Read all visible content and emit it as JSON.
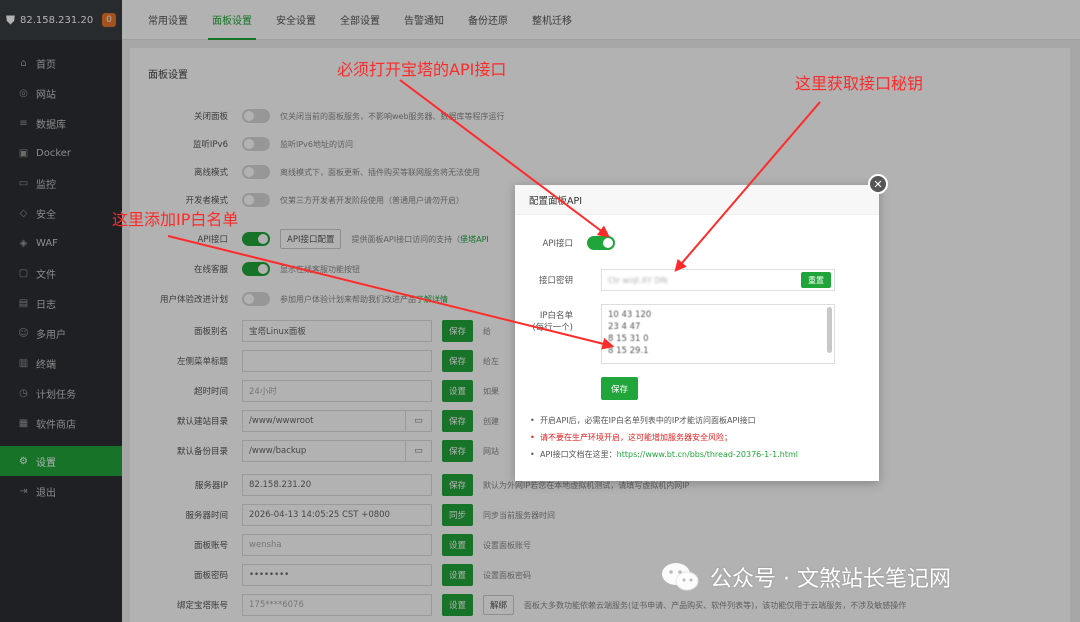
{
  "sidebar": {
    "server_ip": "82.158.231.20",
    "badge": "0",
    "items": [
      {
        "label": "首页",
        "icon": "home-icon",
        "glyph": "⌂"
      },
      {
        "label": "网站",
        "icon": "globe-icon",
        "glyph": "◎"
      },
      {
        "label": "数据库",
        "icon": "database-icon",
        "glyph": "≡"
      },
      {
        "label": "Docker",
        "icon": "docker-icon",
        "glyph": "▣"
      },
      {
        "label": "监控",
        "icon": "monitor-icon",
        "glyph": "▭"
      },
      {
        "label": "安全",
        "icon": "shield-icon",
        "glyph": "◇"
      },
      {
        "label": "WAF",
        "icon": "waf-icon",
        "glyph": "◈"
      },
      {
        "label": "文件",
        "icon": "folder-icon",
        "glyph": "▢"
      },
      {
        "label": "日志",
        "icon": "log-icon",
        "glyph": "▤"
      },
      {
        "label": "多用户",
        "icon": "users-icon",
        "glyph": "☺"
      },
      {
        "label": "终端",
        "icon": "terminal-icon",
        "glyph": "▥"
      },
      {
        "label": "计划任务",
        "icon": "task-icon",
        "glyph": "◷"
      },
      {
        "label": "软件商店",
        "icon": "store-icon",
        "glyph": "▦"
      },
      {
        "label": "设置",
        "icon": "gear-icon",
        "glyph": "⚙"
      },
      {
        "label": "退出",
        "icon": "logout-icon",
        "glyph": "⇥"
      }
    ]
  },
  "tabs": [
    "常用设置",
    "面板设置",
    "安全设置",
    "全部设置",
    "告警通知",
    "备份还原",
    "整机迁移"
  ],
  "main": {
    "title": "面板设置",
    "rows": [
      {
        "label": "关闭面板",
        "type": "toggle",
        "on": false,
        "desc": "仅关闭当前的面板服务，不影响web服务器、数据库等程序运行"
      },
      {
        "label": "监听IPv6",
        "type": "toggle",
        "on": false,
        "desc": "监听IPv6地址的访问"
      },
      {
        "label": "离线模式",
        "type": "toggle",
        "on": false,
        "desc": "离线模式下，面板更新、插件购买等联网服务将无法使用"
      },
      {
        "label": "开发者模式",
        "type": "toggle",
        "on": false,
        "desc": "仅第三方开发者开发阶段使用（普通用户请勿开启）"
      },
      {
        "label": "API接口",
        "type": "toggle-btn",
        "on": true,
        "btn": "API接口配置",
        "desc": "提供面板API接口访问的支持（",
        "desc_link": "堡塔API"
      },
      {
        "label": "在线客服",
        "type": "toggle",
        "on": true,
        "desc": "显示在线客服功能按钮"
      },
      {
        "label": "用户体验改进计划",
        "type": "toggle",
        "on": false,
        "desc": "参加用户体验计划来帮助我们改进产品",
        "desc_link": "了解详情"
      },
      {
        "label": "面板别名",
        "type": "input",
        "value": "宝塔Linux面板",
        "btn": "保存",
        "desc": "给"
      },
      {
        "label": "左侧菜单标题",
        "type": "input",
        "value": "",
        "btn": "保存",
        "desc": "给左"
      },
      {
        "label": "超时时间",
        "type": "input",
        "value": "24小时",
        "placeholder": true,
        "btn": "设置",
        "desc": "如果"
      },
      {
        "label": "默认建站目录",
        "type": "input-folder",
        "value": "/www/wwwroot",
        "btn": "保存",
        "desc": "创建"
      },
      {
        "label": "默认备份目录",
        "type": "input-folder",
        "value": "/www/backup",
        "btn": "保存",
        "desc": "网站"
      },
      {
        "label": "服务器IP",
        "type": "input",
        "value": "82.158.231.20",
        "btn": "保存",
        "desc": "默认为外网IP若您在本地虚拟机测试，请填写虚拟机内网IP"
      },
      {
        "label": "服务器时间",
        "type": "input",
        "value": "2026-04-13 14:05:25 CST +0800",
        "btn": "同步",
        "desc": "同步当前服务器时间"
      },
      {
        "label": "面板账号",
        "type": "input",
        "value": "wensha",
        "placeholder": true,
        "btn": "设置",
        "desc": "设置面板账号"
      },
      {
        "label": "面板密码",
        "type": "input",
        "value": "••••••••",
        "btn": "设置",
        "desc": "设置面板密码"
      },
      {
        "label": "绑定宝塔账号",
        "type": "input",
        "value": "175****6076",
        "placeholder": true,
        "btn": "设置",
        "btn2": "解绑",
        "desc": "面板大多数功能依赖云端服务(证书申请、产品购买、软件列表等)，该功能仅用于云端服务，不涉及敏感操作"
      }
    ]
  },
  "modal": {
    "title": "配置面板API",
    "api_label": "API接口",
    "key_label": "接口密钥",
    "key_value": "Ctr wnJI.XY Dfk",
    "reset_btn": "重置",
    "ip_label": "IP白名单",
    "ip_hint": "(每行一个)",
    "ip_lines": [
      "10  43  120",
      "23  4  47",
      "8  15  31  0",
      "8  15  29.1"
    ],
    "save_btn": "保存",
    "tip1": "开启API后，必需在IP白名单列表中的IP才能访问面板API接口",
    "tip2": "请不要在生产环境开启，这可能增加服务器安全风险；",
    "tip3": "API接口文档在这里：",
    "tip3_link": "https://www.bt.cn/bbs/thread-20376-1-1.html"
  },
  "annotations": {
    "a1": "必须打开宝塔的API接口",
    "a2": "这里获取接口秘钥",
    "a3": "这里添加IP白名单",
    "color": "#ff2a2a"
  },
  "watermark": {
    "text": "公众号 · 文煞站长笔记网"
  }
}
